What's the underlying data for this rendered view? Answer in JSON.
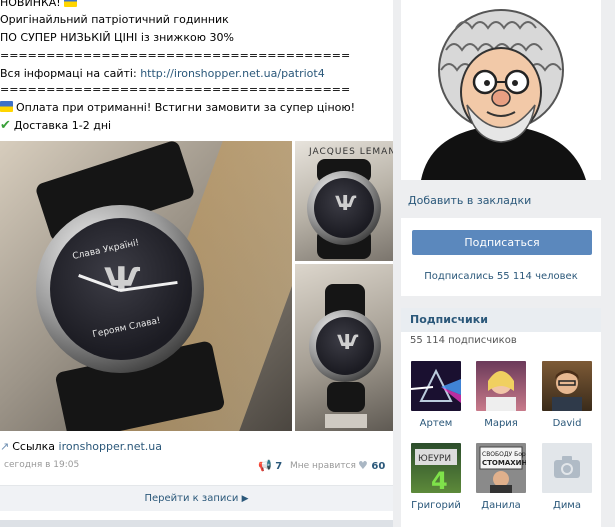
{
  "post": {
    "line1": "НОВИНКА!",
    "line2": "Оригінайльний патріотичний годинник",
    "line3": "ПО СУПЕР НИЗЬКІЙ ЦІНІ із знижкою 30%",
    "separator": "======================================",
    "info_prefix": "Вся інформаці на сайті: ",
    "info_url": "http://ironshopper.net.ua/patriot4",
    "separator2": "======================================",
    "pay_line": "Оплата при отриманні! Встигни замовити за супер ціною!",
    "delivery_line": "Доставка 1-2 дні",
    "watch_text_top": "Слава Україні!",
    "watch_text_bottom": "Героям Слава!",
    "watch_brand": "JACQUES LEMANS",
    "link_label": "Ссылка ",
    "link_domain": "ironshopper.net.ua",
    "date": "сегодня в 19:05",
    "reposts": "7",
    "like_label": "Мне нравится",
    "likes": "60",
    "goto_label": "Перейти к записи"
  },
  "sidebar": {
    "bookmark_label": "Добавить в закладки",
    "subscribe_label": "Подписаться",
    "subscribed_count": "Подписались 55 114 человек",
    "followers_title": "Подписчики",
    "followers_count": "55 114 подписчиков",
    "followers": [
      {
        "name": "Артем"
      },
      {
        "name": "Мария"
      },
      {
        "name": "David"
      },
      {
        "name": "Григорий"
      },
      {
        "name": "Данила"
      },
      {
        "name": "Дима"
      }
    ],
    "danila_sign": "СВОБОДУ Борису СТОМАХИНУ",
    "grigoriy_sign": "ЮЕУРИ"
  },
  "colors": {
    "link": "#2b587a",
    "button": "#5b88bd",
    "header_bg": "#e9edf1"
  }
}
